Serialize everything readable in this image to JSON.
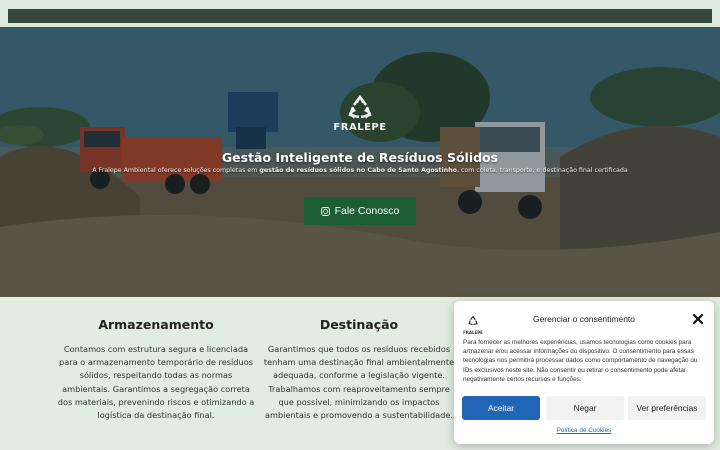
{
  "brand": {
    "name": "FRALEPE"
  },
  "hero": {
    "title": "Gestão Inteligente de Resíduos Sólidos",
    "subtitle_pre": "A Fralepe Ambiental oferece soluções completas em ",
    "subtitle_bold": "gestão de resíduos sólidos no Cabo de Santo Agostinho",
    "subtitle_post": ", com coleta, transporte, e destinação final certificada",
    "cta_label": "Fale Conosco",
    "cta_icon": "whatsapp-icon"
  },
  "services": [
    {
      "title": "Armazenamento",
      "lines": [
        "Contamos com estrutura segura e licenciada",
        "para o armazenamento temporário de resíduos",
        "sólidos, respeitando todas as normas",
        "ambientais. Garantimos a segregação correta",
        "dos materiais, prevenindo riscos e otimizando a",
        "logística da destinação final."
      ]
    },
    {
      "title": "Destinação",
      "lines": [
        "Garantimos que todos os resíduos recebidos",
        "tenham uma destinação final ambientalmente",
        "adequada, conforme a legislação vigente.",
        "Trabalhamos com reaproveitamento sempre",
        "que possível, minimizando os impactos",
        "ambientais e promovendo a sustentabilidade."
      ]
    }
  ],
  "consent": {
    "logo_text": "FRALEPE",
    "title": "Gerenciar o consentimento",
    "text": "Para fornecer as melhores experiências, usamos tecnologias como cookies para armazenar e/ou acessar informações do dispositivo. O consentimento para essas tecnologias nos permitirá processar dados como comportamento de navegação ou IDs exclusivos neste site. Não consentir ou retirar o consentimento pode afetar negativamente certos recursos e funções.",
    "accept": "Aceitar",
    "deny": "Negar",
    "preferences": "Ver preferências",
    "policy_link": "Política de Cookies",
    "accent_color": "#2065b6"
  },
  "colors": {
    "cta": "#1d5d33",
    "section_bg": "#e1ede1",
    "topbar": "#38493b"
  }
}
